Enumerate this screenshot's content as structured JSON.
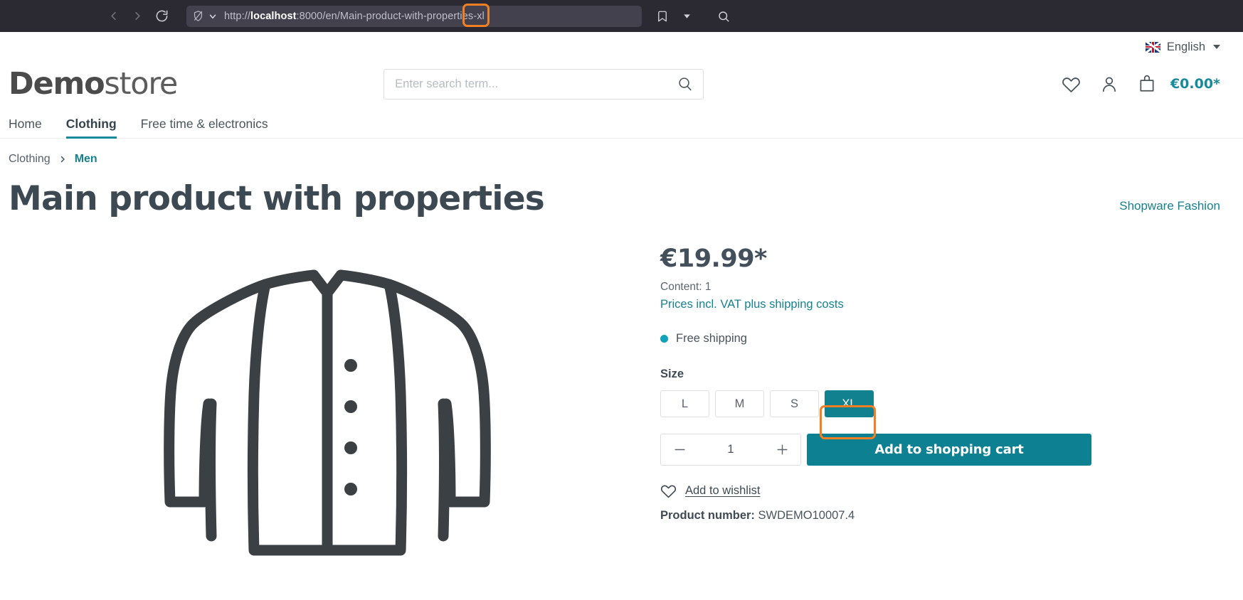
{
  "browser": {
    "back_icon": "chevron-left-icon",
    "forward_icon": "chevron-right-icon",
    "reload_icon": "reload-icon",
    "shield_icon": "shield-off-icon",
    "permissions_icon": "chevron-down-icon",
    "url_scheme": "http://",
    "url_host": "localhost",
    "url_rest": ":8000/en/Main-product-with-properties",
    "url_highlight": "-xl",
    "bookmark_icon": "bookmark-icon",
    "bookmark_caret_icon": "caret-down-icon",
    "search_icon": "search-icon"
  },
  "topbar": {
    "flag_icon": "union-jack-flag-icon",
    "language": "English",
    "caret_icon": "caret-down-icon"
  },
  "header": {
    "logo_bold": "Demo",
    "logo_light": "store",
    "search_placeholder": "Enter search term...",
    "search_value": "",
    "search_icon": "search-icon",
    "wishlist_icon": "heart-icon",
    "account_icon": "user-icon",
    "cart_icon": "shopping-bag-icon",
    "cart_total": "€0.00*",
    "accent_color": "#178a99"
  },
  "nav": {
    "items": [
      {
        "label": "Home",
        "active": false
      },
      {
        "label": "Clothing",
        "active": true
      },
      {
        "label": "Free time & electronics",
        "active": false
      }
    ]
  },
  "breadcrumb": {
    "items": [
      {
        "label": "Clothing",
        "current": false
      },
      {
        "label": "Men",
        "current": true
      }
    ],
    "separator_icon": "chevron-right-icon"
  },
  "product": {
    "title": "Main product with properties",
    "manufacturer": "Shopware Fashion",
    "image_alt": "jacket-illustration",
    "price": "€19.99*",
    "content": "Content: 1",
    "tax_note": "Prices incl. VAT plus shipping costs",
    "delivery_status": "Free shipping",
    "delivery_dot_color": "#11a1b8",
    "property_label": "Size",
    "sizes": [
      {
        "label": "L",
        "selected": false
      },
      {
        "label": "M",
        "selected": false
      },
      {
        "label": "S",
        "selected": false
      },
      {
        "label": "XL",
        "selected": true
      }
    ],
    "qty_minus_icon": "minus-icon",
    "qty_value": "1",
    "qty_plus_icon": "plus-icon",
    "add_to_cart": "Add to shopping cart",
    "wishlist_icon": "heart-icon",
    "wishlist_label": "Add to wishlist",
    "product_number_label": "Product number:",
    "product_number_value": "SWDEMO10007.4"
  },
  "annotations": {
    "highlight_color": "#f28022",
    "targets": [
      "url-suffix-xl",
      "size-button-xl"
    ]
  }
}
